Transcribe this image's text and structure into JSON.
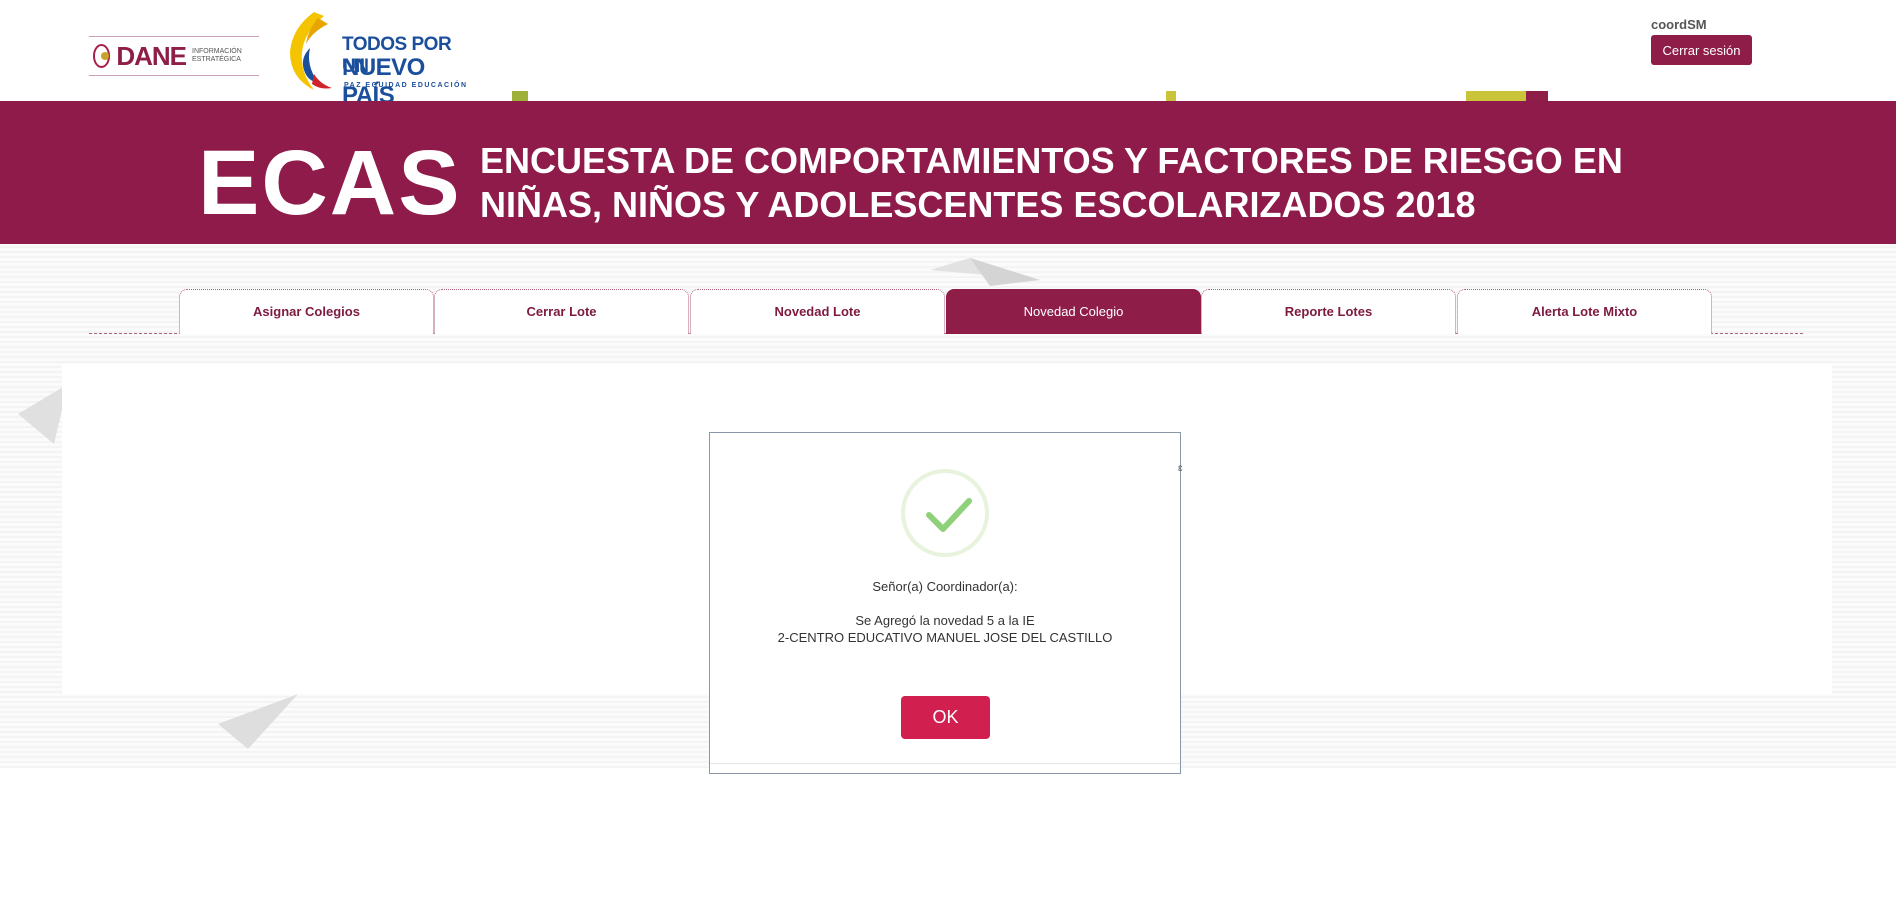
{
  "header": {
    "dane_logo_text": "DANE",
    "dane_logo_sub": "INFORMACIÓN ESTRATÉGICA",
    "gov_logo_line1": "TODOS POR UN",
    "gov_logo_line2": "NUEVO PAÍS",
    "gov_logo_line3": "PAZ  EQUIDAD  EDUCACIÓN",
    "username": "coordSM",
    "logout_label": "Cerrar sesión"
  },
  "banner": {
    "acronym": "ECAS",
    "line1": "ENCUESTA DE COMPORTAMIENTOS Y FACTORES DE RIESGO EN",
    "line2": "NIÑAS, NIÑOS Y ADOLESCENTES ESCOLARIZADOS 2018"
  },
  "tabs": [
    {
      "label": "Asignar Colegios",
      "active": false
    },
    {
      "label": "Cerrar Lote",
      "active": false
    },
    {
      "label": "Novedad Lote",
      "active": false
    },
    {
      "label": "Novedad Colegio",
      "active": true
    },
    {
      "label": "Reporte Lotes",
      "active": false
    },
    {
      "label": "Alerta Lote Mixto",
      "active": false
    }
  ],
  "modal": {
    "icon": "success-check-icon",
    "greeting": "Señor(a) Coordinador(a):",
    "message_line1": "Se Agregó la novedad 5 a la IE",
    "message_line2": "2-CENTRO EDUCATIVO MANUEL JOSE DEL CASTILLO",
    "ok_label": "OK"
  },
  "colors": {
    "brand": "#8e1d48",
    "ok_button": "#d11f50",
    "check": "#8fd17a"
  }
}
